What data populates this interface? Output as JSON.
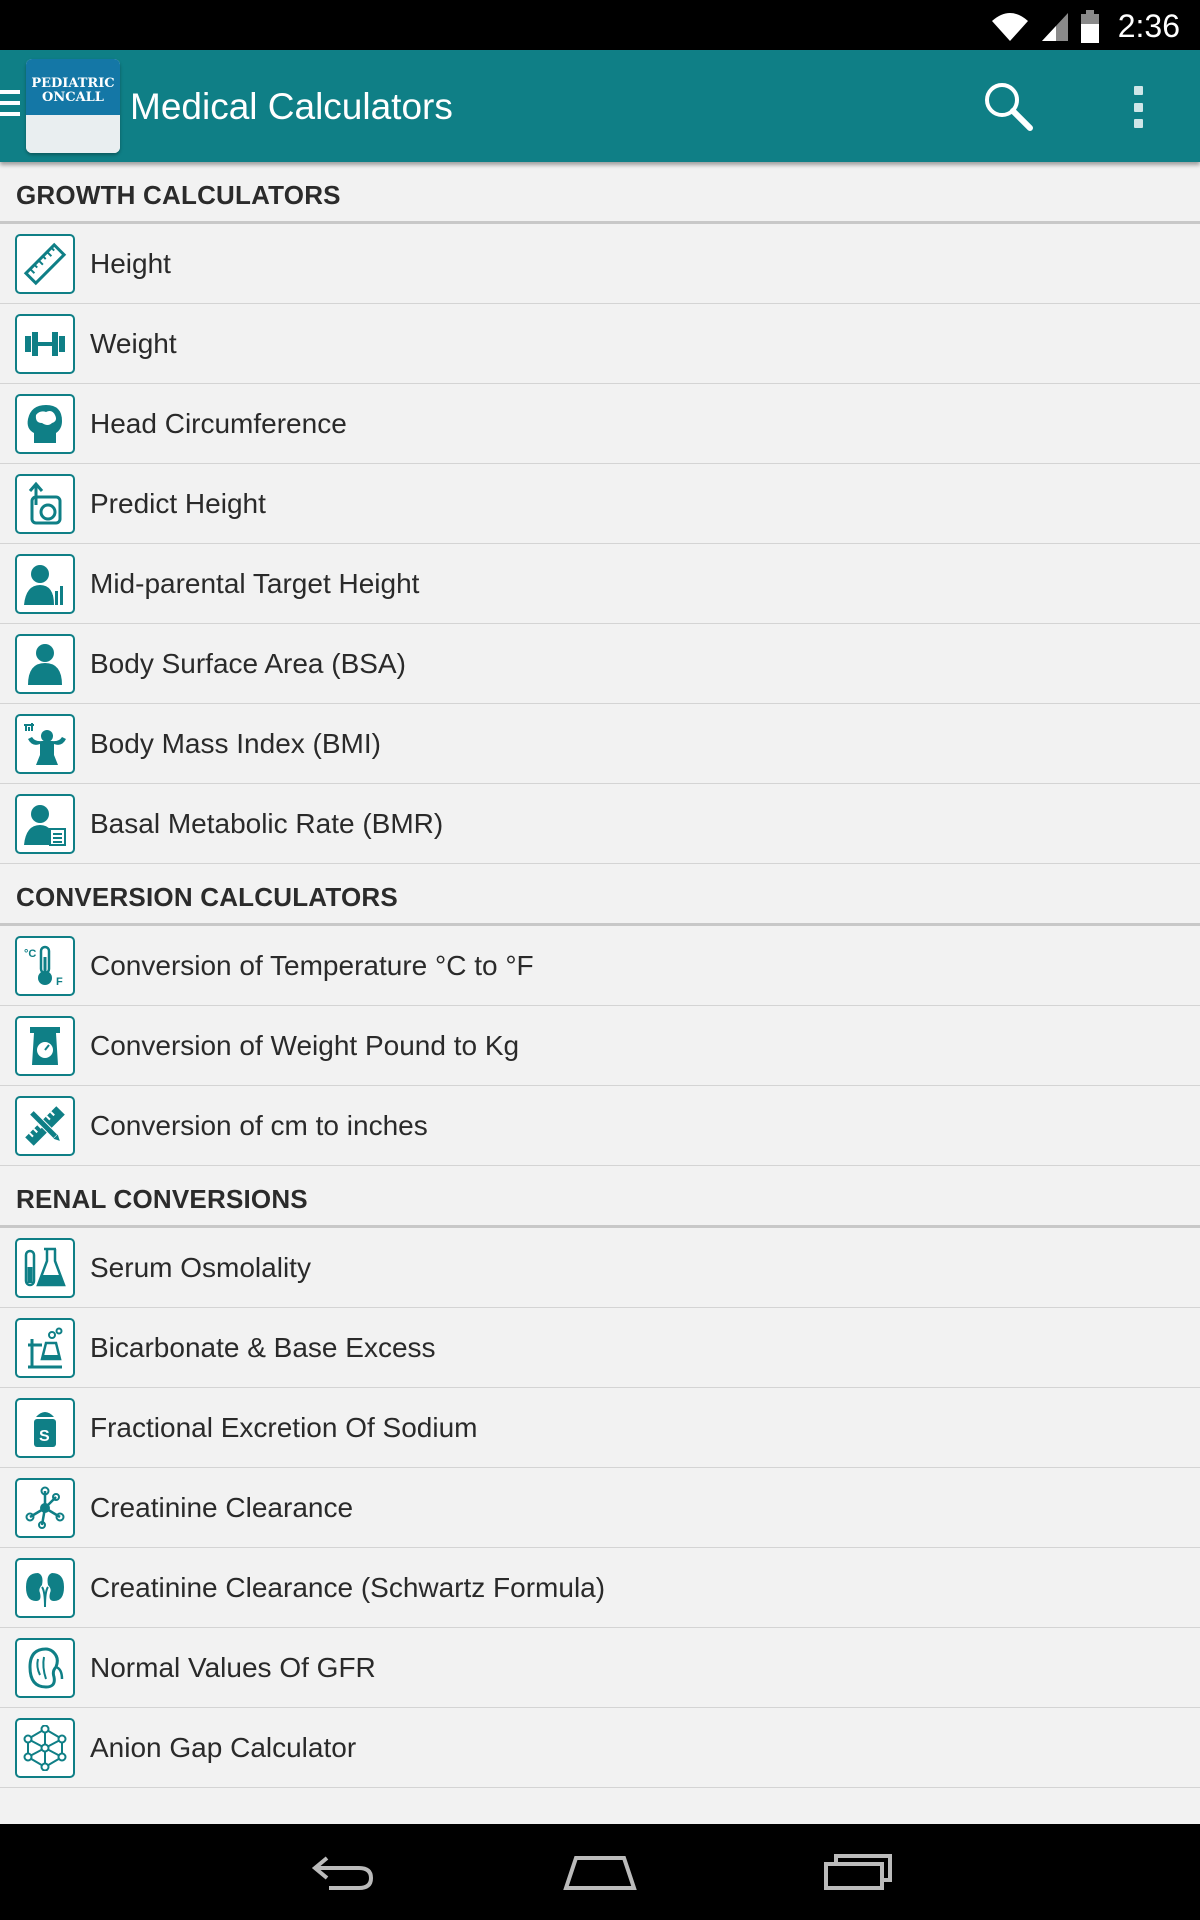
{
  "status": {
    "time": "2:36"
  },
  "app": {
    "logo_line1": "PEDIATRIC",
    "logo_line2": "ONCALL",
    "title": "Medical Calculators"
  },
  "sections": [
    {
      "title": "GROWTH CALCULATORS",
      "items": [
        {
          "label": "Height",
          "icon": "ruler-icon"
        },
        {
          "label": "Weight",
          "icon": "dumbbell-icon"
        },
        {
          "label": "Head Circumference",
          "icon": "head-brain-icon"
        },
        {
          "label": "Predict Height",
          "icon": "predict-height-icon"
        },
        {
          "label": "Mid-parental Target Height",
          "icon": "person-chart-icon"
        },
        {
          "label": "Body Surface Area (BSA)",
          "icon": "body-icon"
        },
        {
          "label": "Body Mass Index (BMI)",
          "icon": "muscle-icon"
        },
        {
          "label": "Basal Metabolic Rate (BMR)",
          "icon": "person-calculator-icon"
        }
      ]
    },
    {
      "title": "CONVERSION CALCULATORS",
      "items": [
        {
          "label": "Conversion of Temperature °C to °F",
          "icon": "thermometer-icon"
        },
        {
          "label": "Conversion of Weight Pound to Kg",
          "icon": "scale-icon"
        },
        {
          "label": "Conversion of cm to inches",
          "icon": "ruler-pencil-icon"
        }
      ]
    },
    {
      "title": "RENAL CONVERSIONS",
      "items": [
        {
          "label": "Serum Osmolality",
          "icon": "flask-icon"
        },
        {
          "label": "Bicarbonate & Base Excess",
          "icon": "lab-stand-icon"
        },
        {
          "label": "Fractional Excretion Of Sodium",
          "icon": "salt-shaker-icon"
        },
        {
          "label": "Creatinine Clearance",
          "icon": "molecule-icon"
        },
        {
          "label": "Creatinine Clearance (Schwartz Formula)",
          "icon": "kidneys-icon"
        },
        {
          "label": "Normal Values Of GFR",
          "icon": "kidney-icon"
        },
        {
          "label": "Anion Gap Calculator",
          "icon": "network-icon"
        }
      ]
    }
  ],
  "colors": {
    "app_bar": "#0f7f86",
    "icon_accent": "#0f7f86",
    "status_bar": "#000000"
  }
}
